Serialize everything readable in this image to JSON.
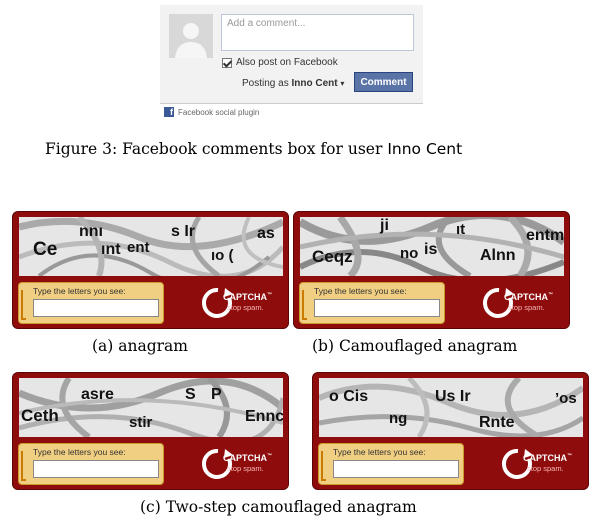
{
  "facebook_box": {
    "input_placeholder": "Add a comment...",
    "also_post_label": "Also post on Facebook",
    "posting_as_prefix": "Posting as",
    "posting_as_user": "Inno Cent",
    "caret": "▾",
    "comment_button": "Comment",
    "plugin_label": "Facebook social plugin",
    "brand_color": "#3b5998",
    "button_color": "#5b74a8"
  },
  "figure3_caption": {
    "prefix": "Figure 3: Facebook comments box for user",
    "user": "Inno Cent"
  },
  "captcha_common": {
    "prompt": "Type the letters you see:",
    "brand": "CAPTCHA",
    "tm": "™",
    "tagline": "stop spam.",
    "frame_color": "#8f0c0c",
    "entry_color": "#f1cf82"
  },
  "captchas": [
    {
      "words": [
        "Ce",
        "nnı",
        "ınt",
        "ent",
        "s Ir",
        "as",
        "ıo ("
      ]
    },
    {
      "words": [
        "Ceqz",
        "ji",
        "no",
        "is",
        "ıt",
        "Alnn",
        "entm"
      ]
    },
    {
      "words": [
        "Ceth",
        "asre",
        "stir",
        "S",
        "P",
        "Ennc"
      ]
    },
    {
      "words": [
        "o Cis",
        "ng",
        "Us Ir",
        "Rnte",
        "’os"
      ]
    }
  ],
  "captions": {
    "a": "(a) anagram",
    "b": "(b) Camouflaged anagram",
    "c": "(c) Two-step camouflaged anagram"
  }
}
